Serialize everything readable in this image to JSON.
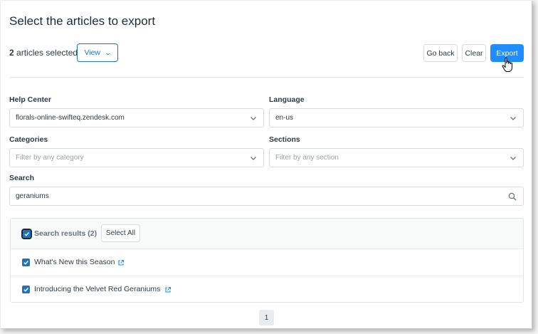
{
  "header": {
    "title": "Select the articles to export",
    "selected_count": "2",
    "selected_suffix": " articles selected",
    "view_label": "View",
    "go_back_label": "Go back",
    "clear_label": "Clear",
    "export_label": "Export"
  },
  "filters": {
    "help_center": {
      "label": "Help Center",
      "value": "florals-online-swifteq.zendesk.com"
    },
    "language": {
      "label": "Language",
      "value": "en-us"
    },
    "categories": {
      "label": "Categories",
      "placeholder": "Filter by any category"
    },
    "sections": {
      "label": "Sections",
      "placeholder": "Filter by any section"
    },
    "search": {
      "label": "Search",
      "value": "geraniums"
    }
  },
  "results": {
    "header_label": "Search results (2)",
    "select_all_label": "Select All",
    "items": [
      {
        "title": "What's New this Season",
        "checked": true
      },
      {
        "title": "Introducing the Velvet Red Geraniums",
        "checked": true
      }
    ]
  },
  "pagination": {
    "current_page": "1"
  },
  "colors": {
    "primary": "#1f8cff",
    "link": "#1f73b7",
    "border": "#d8dcde"
  },
  "icons": {
    "dropdown": "chevron-down-icon",
    "search": "magnifier-icon",
    "external": "external-link-icon",
    "check": "checkmark-icon",
    "cursor": "hand-pointer-icon"
  }
}
